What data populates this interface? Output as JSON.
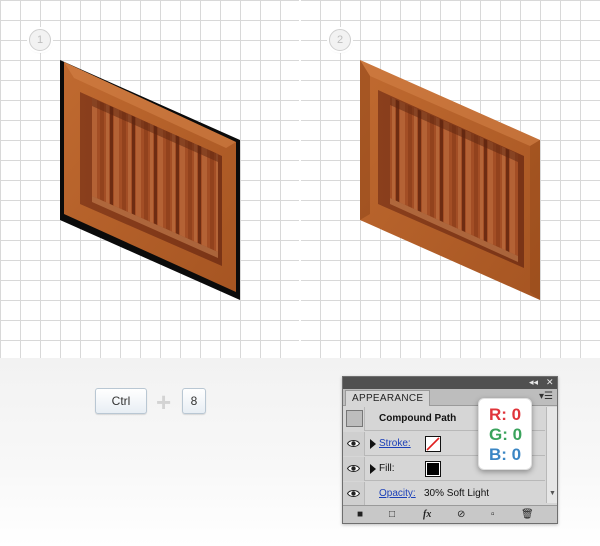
{
  "steps": [
    {
      "number": "1"
    },
    {
      "number": "2"
    }
  ],
  "shortcut": {
    "key1": "Ctrl",
    "key2": "8"
  },
  "panel": {
    "tab_label": "APPEARANCE",
    "header_row": {
      "label": "Compound Path"
    },
    "rows": [
      {
        "label": "Stroke:",
        "is_link": true
      },
      {
        "label": "Fill:",
        "is_link": false
      },
      {
        "label": "Opacity:",
        "value": "30% Soft Light",
        "is_link": true
      }
    ]
  },
  "rgb": {
    "r": "R: 0",
    "g": "G: 0",
    "b": "B: 0"
  },
  "colors": {
    "r": "#e0343a",
    "g": "#3aa35c",
    "b": "#3b86c4",
    "link": "#1a3fb8",
    "wood_dark": "#7a3518",
    "wood_frame": "#b4622c"
  },
  "icons": [
    "eye-icon",
    "disclosure-triangle-icon",
    "panel-menu-icon",
    "collapse-icon",
    "close-icon",
    "fx-icon",
    "clear-icon",
    "duplicate-icon",
    "trash-icon"
  ]
}
